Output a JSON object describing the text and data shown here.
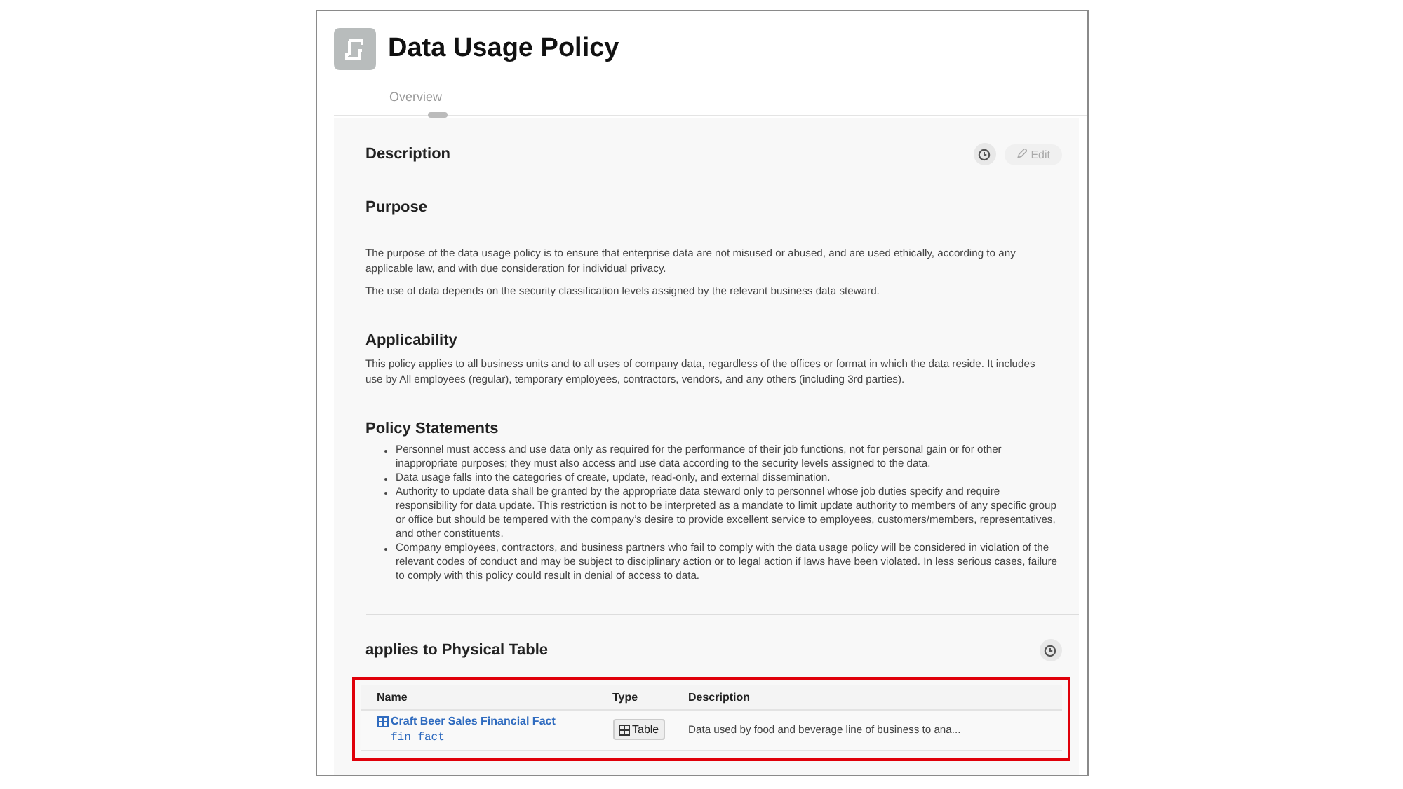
{
  "header": {
    "title": "Data Usage Policy"
  },
  "tabs": [
    {
      "label": "Overview",
      "selected": true
    }
  ],
  "description": {
    "heading": "Description",
    "edit_label": "Edit",
    "edit_disabled": true
  },
  "sections": [
    {
      "heading": "Purpose",
      "kind": "paragraphs",
      "paragraphs": [
        "The purpose of the data usage policy is to ensure that enterprise data are not misused or abused, and are used ethically, according to any applicable law, and with due consideration for individual privacy.",
        "The use of data depends on the security classification levels assigned by the relevant business data steward."
      ]
    },
    {
      "heading": "Applicability",
      "kind": "paragraphs",
      "paragraphs": [
        "This policy applies to all business units and to all uses of company data, regardless of the offices or format in which the data reside.  It includes use by All employees (regular), temporary employees, contractors, vendors, and any others (including 3rd parties)."
      ]
    },
    {
      "heading": "Policy Statements",
      "kind": "bullets",
      "paragraphs": [
        "Personnel must access and use data only as required for the performance of their job functions, not for personal gain or for other inappropriate purposes; they must also access and use data according to the security levels assigned to the data.",
        "Data usage falls into the categories of create, update, read-only, and external dissemination.",
        "Authority to update data shall be granted by the appropriate data steward only to personnel whose job duties specify and require responsibility for data update.  This restriction is not to be interpreted as a mandate to limit update authority to members of any specific group or office but should be tempered with the company’s desire to provide excellent service to employees, customers/members, representatives, and other constituents.",
        "Company employees, contractors, and business partners who fail to comply with the data usage policy will be considered in violation of the relevant codes of conduct and may be subject to disciplinary action or to legal action if laws have been violated.  In less serious cases, failure to comply with this policy could result in denial of access to data."
      ]
    }
  ],
  "relation": {
    "heading": "applies to Physical Table",
    "highlighted": true,
    "columns": [
      "Name",
      "Type",
      "Description"
    ],
    "rows": [
      {
        "name": "Craft Beer Sales Financial Fact",
        "code": "fin_fact",
        "type": "Table",
        "description": "Data used by food and beverage line of business to ana..."
      }
    ]
  }
}
